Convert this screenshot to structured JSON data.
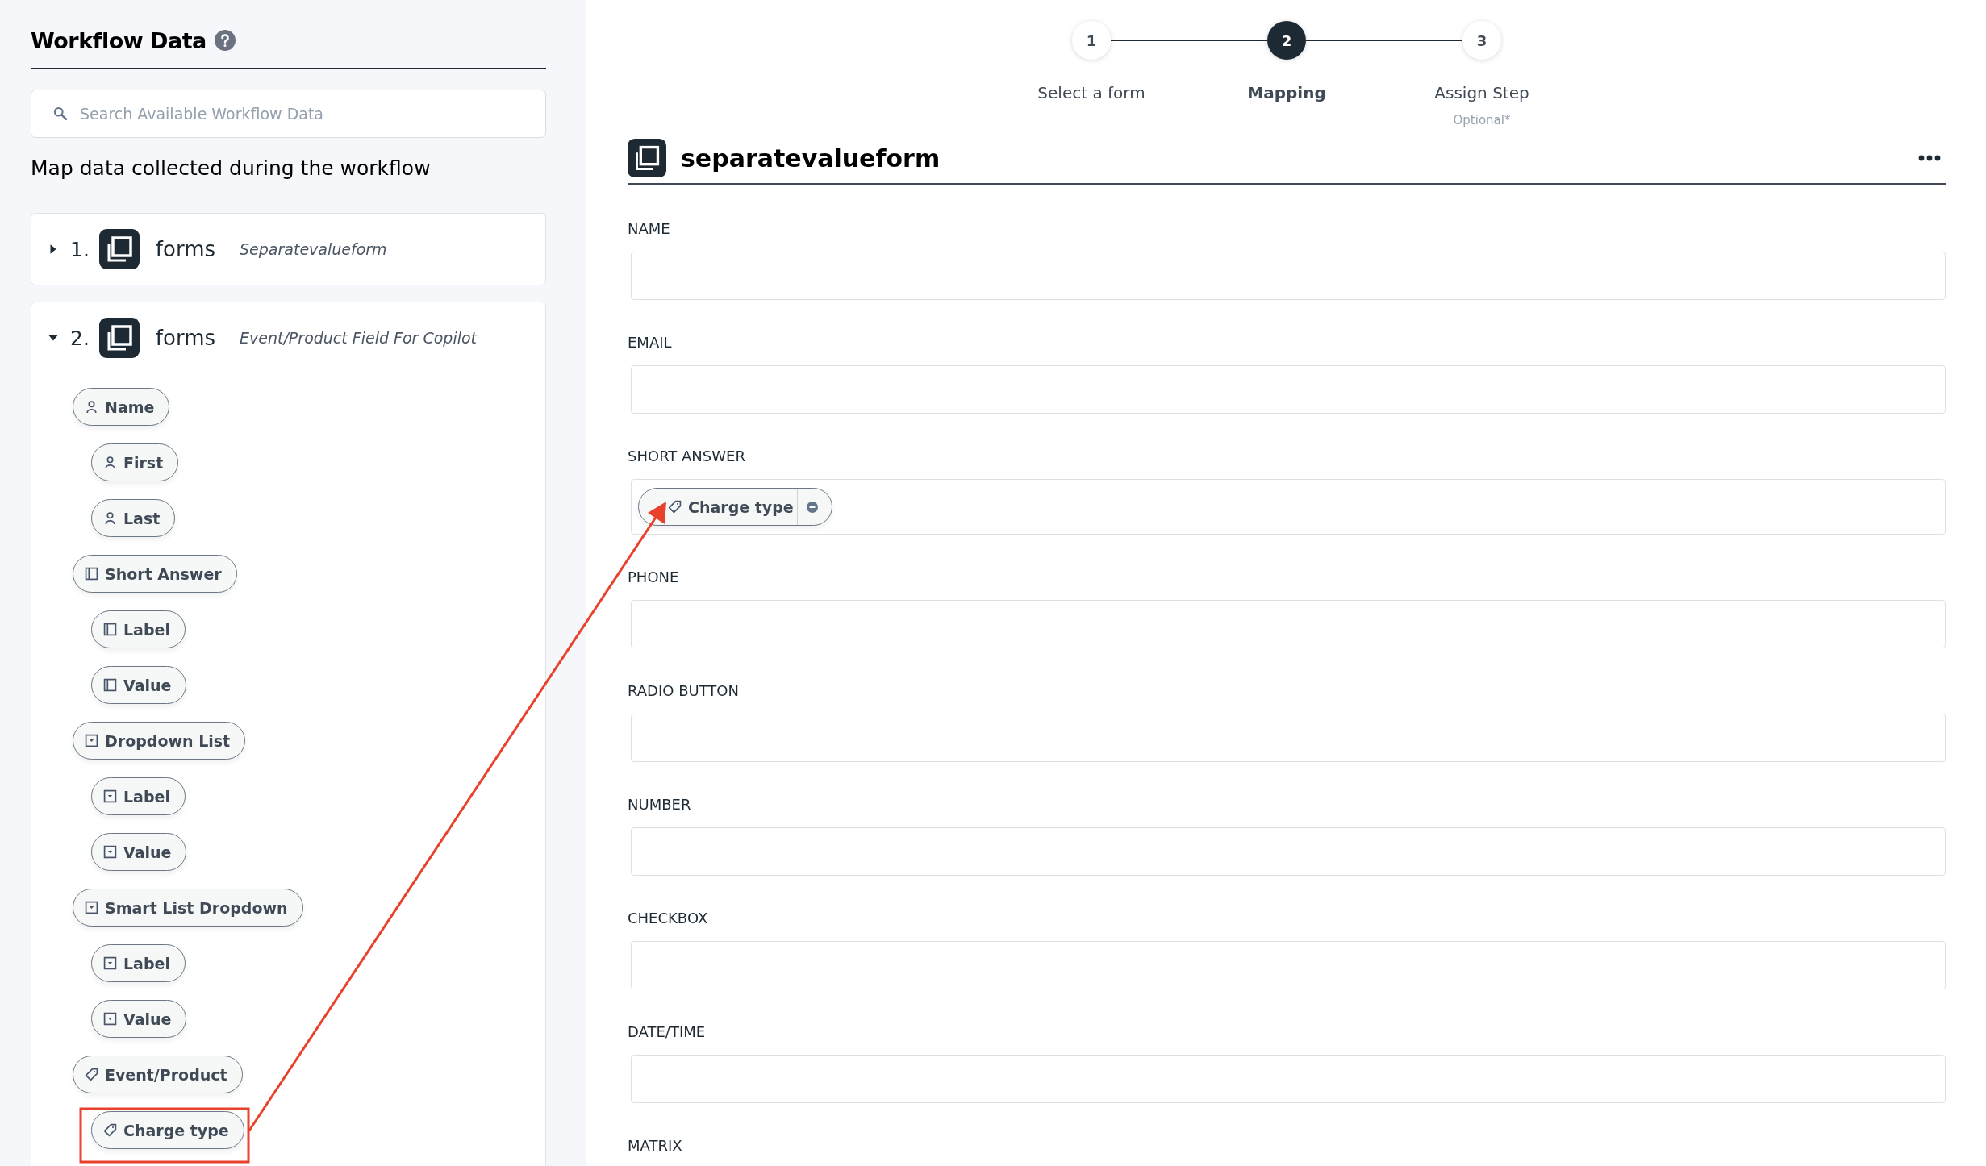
{
  "sidebar": {
    "title": "Workflow Data",
    "search": {
      "placeholder": "Search Available Workflow Data"
    },
    "description": "Map data collected during the workflow",
    "sources": [
      {
        "number": "1.",
        "name": "forms",
        "subtitle": "Separatevalueform",
        "expanded": false
      },
      {
        "number": "2.",
        "name": "forms",
        "subtitle": "Event/Product Field For Copilot",
        "expanded": true,
        "fields": [
          {
            "label": "Name",
            "kind": "person",
            "children": [
              {
                "label": "First",
                "kind": "person"
              },
              {
                "label": "Last",
                "kind": "person"
              }
            ]
          },
          {
            "label": "Short Answer",
            "kind": "text",
            "children": [
              {
                "label": "Label",
                "kind": "text"
              },
              {
                "label": "Value",
                "kind": "text"
              }
            ]
          },
          {
            "label": "Dropdown List",
            "kind": "dropdown",
            "children": [
              {
                "label": "Label",
                "kind": "dropdown"
              },
              {
                "label": "Value",
                "kind": "dropdown"
              }
            ]
          },
          {
            "label": "Smart List Dropdown",
            "kind": "dropdown",
            "children": [
              {
                "label": "Label",
                "kind": "dropdown"
              },
              {
                "label": "Value",
                "kind": "dropdown"
              }
            ]
          },
          {
            "label": "Event/Product",
            "kind": "tag",
            "children": [
              {
                "label": "Charge type",
                "kind": "tag"
              }
            ]
          }
        ]
      }
    ]
  },
  "steps": [
    {
      "number": "1",
      "label": "Select a form",
      "selected": false
    },
    {
      "number": "2",
      "label": "Mapping",
      "selected": true
    },
    {
      "number": "3",
      "label": "Assign Step",
      "note": "Optional*",
      "selected": false
    }
  ],
  "form": {
    "title": "separatevalueform",
    "fields": [
      {
        "label": "NAME"
      },
      {
        "label": "EMAIL"
      },
      {
        "label": "SHORT ANSWER",
        "chips": [
          {
            "label": "Charge type",
            "kind": "tag"
          }
        ]
      },
      {
        "label": "PHONE"
      },
      {
        "label": "RADIO BUTTON"
      },
      {
        "label": "NUMBER"
      },
      {
        "label": "CHECKBOX"
      },
      {
        "label": "DATE/TIME"
      },
      {
        "label": "MATRIX"
      }
    ]
  }
}
